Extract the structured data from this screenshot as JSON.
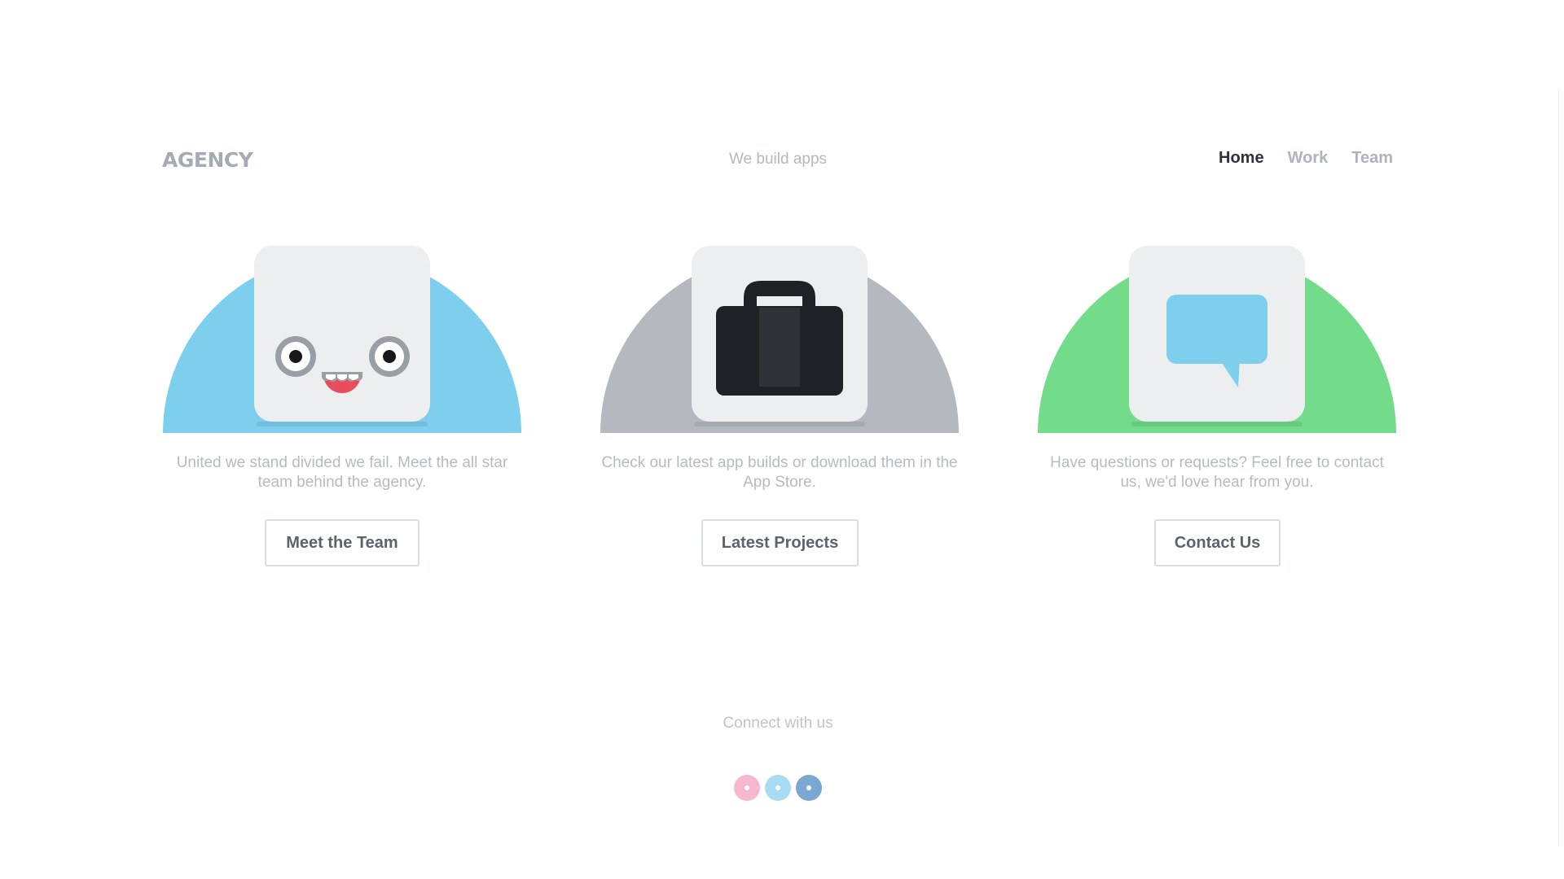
{
  "header": {
    "logo": "AGENCY",
    "tagline": "We build apps",
    "nav": [
      {
        "label": "Home",
        "active": true
      },
      {
        "label": "Work",
        "active": false
      },
      {
        "label": "Team",
        "active": false
      }
    ]
  },
  "cards": [
    {
      "icon": "robot-face-icon",
      "accent": "#7ecfee",
      "description": "United we stand divided we fail. Meet the all star team behind the agency.",
      "button": "Meet the Team"
    },
    {
      "icon": "shopping-bag-icon",
      "accent": "#b4b9c0",
      "description": "Check our latest app builds or download them in the App Store.",
      "button": "Latest Projects"
    },
    {
      "icon": "chat-bubble-icon",
      "accent": "#72dc8a",
      "description": "Have questions or requests? Feel free to contact us, we'd love hear from you.",
      "button": "Contact Us"
    }
  ],
  "footer": {
    "connect": "Connect with us",
    "socials": [
      {
        "icon": "social-pink-icon",
        "color": "#f7b7cf"
      },
      {
        "icon": "social-light-blue-icon",
        "color": "#a9dbf2"
      },
      {
        "icon": "social-blue-icon",
        "color": "#7aa8d2"
      }
    ]
  }
}
